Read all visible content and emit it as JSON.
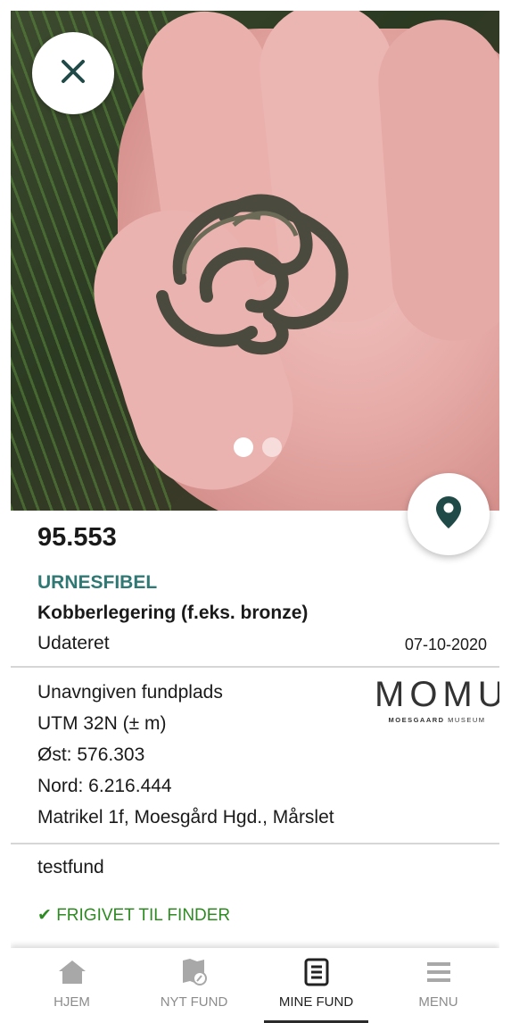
{
  "find": {
    "number": "95.553",
    "type": "URNESFIBEL",
    "material": "Kobberlegering (f.eks. bronze)",
    "dating": "Udateret",
    "date": "07-10-2020"
  },
  "location": {
    "site": "Unavngiven fundplads",
    "utm": "UTM 32N (± m)",
    "east": "Øst: 576.303",
    "north": "Nord: 6.216.444",
    "cadastre": "Matrikel 1f, Moesgård Hgd., Mårslet"
  },
  "museum": {
    "logo": "MOMU",
    "subtitle_bold": "MOESGAARD",
    "subtitle_rest": "MUSEUM"
  },
  "note": "testfund",
  "status": {
    "check": "✔",
    "text": "FRIGIVET TIL FINDER"
  },
  "gallery": {
    "slide_count": 2,
    "active_index": 0
  },
  "nav": {
    "items": [
      {
        "label": "HJEM",
        "icon": "home-icon"
      },
      {
        "label": "NYT FUND",
        "icon": "new-find-icon"
      },
      {
        "label": "MINE FUND",
        "icon": "my-finds-icon"
      },
      {
        "label": "MENU",
        "icon": "menu-icon"
      }
    ],
    "active": "MINE FUND"
  },
  "colors": {
    "accent": "#2f7873",
    "status_green": "#2e8b22",
    "icon_dark": "#1f4a47"
  }
}
